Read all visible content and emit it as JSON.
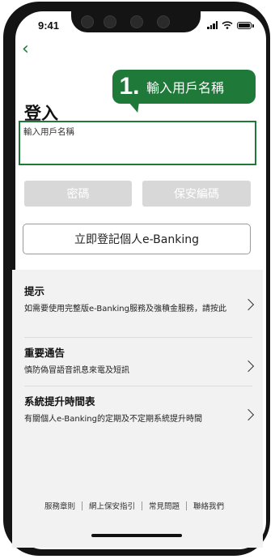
{
  "status": {
    "time": "9:41"
  },
  "callout": {
    "number": "1.",
    "text": "輸入用戶名稱"
  },
  "login": {
    "title": "登入",
    "username_label": "輸入用戶名稱",
    "password_button": "密碼",
    "security_code_button": "保安編碼",
    "register_button": "立即登記個人e-Banking"
  },
  "sections": [
    {
      "title": "提示",
      "body": "如需要使用完整版e-Banking服務及強積金服務，請按此"
    },
    {
      "title": "重要通告",
      "body": "慎防偽冒語音訊息來電及短訊"
    },
    {
      "title": "系統提升時間表",
      "body": "有關個人e-Banking的定期及不定期系統提升時間"
    }
  ],
  "footer": [
    "服務章則",
    "網上保安指引",
    "常見問題",
    "聯絡我們"
  ],
  "colors": {
    "brand_green": "#1f7a3a",
    "disabled_gray": "#d8d8d8"
  },
  "icons": {
    "back": "chevron-left-icon",
    "more": "chevron-right-icon"
  }
}
